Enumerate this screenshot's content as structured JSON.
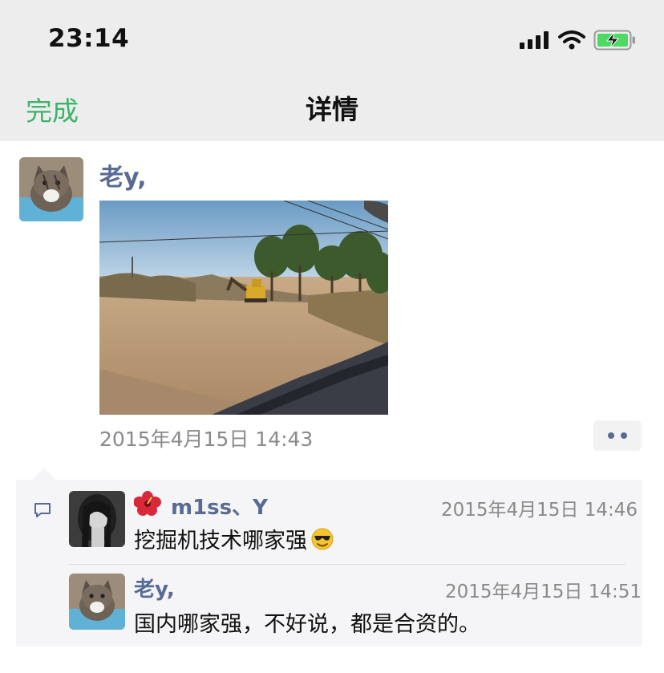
{
  "status_bar": {
    "time": "23:14",
    "icons": [
      "signal-icon",
      "wifi-icon",
      "battery-charging-icon"
    ]
  },
  "nav": {
    "done_label": "完成",
    "title": "详情"
  },
  "post": {
    "author": "老y,",
    "time": "2015年4月15日 14:43",
    "actions_icon": "more-dots-icon"
  },
  "comments": [
    {
      "author": "m1ss、Y",
      "time": "2015年4月15日 14:46",
      "text": "挖掘机技术哪家强",
      "emoji": "😎"
    },
    {
      "author": "老y,",
      "time": "2015年4月15日 14:51",
      "text": "国内哪家强，不好说，都是合资的。"
    }
  ],
  "colors": {
    "nav_bg": "#ededed",
    "accent_green": "#3cb46a",
    "link_blue": "#576b95",
    "muted_gray": "#8a8a8a",
    "comment_bg": "#f5f5f7"
  }
}
